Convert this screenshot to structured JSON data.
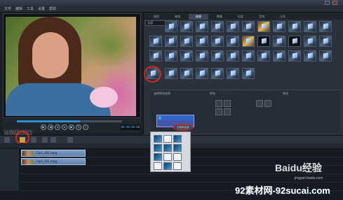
{
  "menubar": {
    "items": [
      "文件",
      "编辑",
      "工具",
      "设置",
      "帮助"
    ]
  },
  "tabs": [
    "捕获",
    "编辑",
    "效果",
    "覆叠",
    "标题",
    "音频",
    "分享"
  ],
  "active_tab": "效果",
  "filter_value": "全部",
  "timecode": "00:00:00:00",
  "annotation": "时间轴视图",
  "options": {
    "heading": "选择转场效果",
    "col2": "转场",
    "col3": "修改"
  },
  "dropdown_selected": "无",
  "apply_label": "应用到全部",
  "clips": [
    "Clip1_001.mpg",
    "Clip1_001.mpg"
  ],
  "watermarks": {
    "baidu": "Baidu经验",
    "url": "92素材网-92sucai.com",
    "sub": "jingyan.baidu.com"
  },
  "colors": {
    "accent": "#2c8fd0",
    "highlight": "#d5261e",
    "dropdown": "#4357a6"
  }
}
